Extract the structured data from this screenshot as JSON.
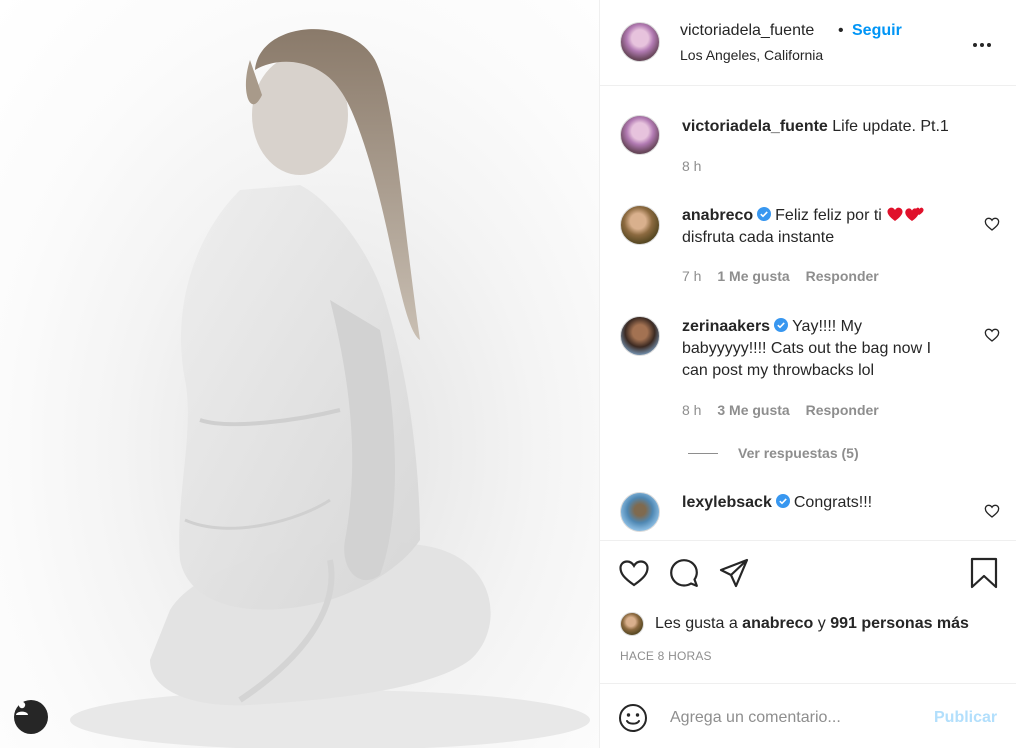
{
  "post": {
    "owner": "victoriadela_fuente",
    "dot": "•",
    "follow_label": "Seguir",
    "location": "Los Angeles, California",
    "more_icon": "more-horizontal-icon"
  },
  "caption": {
    "author": "victoriadela_fuente",
    "text": "Life update. Pt.1",
    "time": "8 h"
  },
  "comments": [
    {
      "author": "anabreco",
      "verified": true,
      "line1": "Feliz feliz por ti",
      "line2": "disfruta cada instante",
      "time": "7 h",
      "likes": "1 Me gusta",
      "reply": "Responder"
    },
    {
      "author": "zerinaakers",
      "verified": true,
      "line1": "Yay!!!! My",
      "line2": "babyyyyy!!!! Cats out the bag now I",
      "line3": "can post my throwbacks lol",
      "time": "8 h",
      "likes": "3 Me gusta",
      "reply": "Responder",
      "view_replies": "Ver respuestas (5)"
    },
    {
      "author": "lexylebsack",
      "verified": true,
      "line1": "Congrats!!!"
    }
  ],
  "likes": {
    "prefix": "Les gusta a ",
    "user": "anabreco",
    "middle": " y ",
    "others": "991 personas más"
  },
  "timestamp": "HACE 8 HORAS",
  "composer": {
    "placeholder": "Agrega un comentario...",
    "publish_label": "Publicar"
  },
  "colors": {
    "accent": "#0095f6",
    "publish_disabled": "#b2dffc",
    "verified": "#3897f0",
    "secondary_text": "#8e8e8e"
  }
}
